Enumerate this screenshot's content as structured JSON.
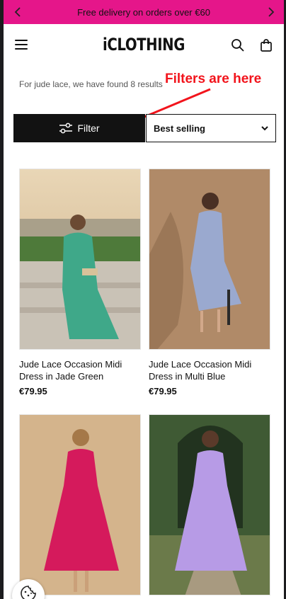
{
  "promo": {
    "text": "Free delivery on orders over €60"
  },
  "header": {
    "logo": "iCLOTHING"
  },
  "search": {
    "results_text": "For jude lace, we have found 8 results"
  },
  "annotation": {
    "text": "Filters are here",
    "color": "#f2141c"
  },
  "toolbar": {
    "filter_label": "Filter",
    "sort_selected": "Best selling"
  },
  "products": [
    {
      "name": "Jude Lace Occasion Midi Dress in Jade Green",
      "price": "€79.95",
      "dress_color": "#3fa889",
      "bg": "#d9c6a4"
    },
    {
      "name": "Jude Lace Occasion Midi Dress in Multi Blue",
      "price": "€79.95",
      "dress_color": "#9aa9cf",
      "bg": "#b08a68"
    },
    {
      "name": "",
      "price": "",
      "dress_color": "#d51a5c",
      "bg": "#d4b48c"
    },
    {
      "name": "",
      "price": "",
      "dress_color": "#b79be6",
      "bg": "#3f5a34"
    }
  ],
  "colors": {
    "accent": "#e5168a",
    "filter_bg": "#121212"
  },
  "icons": [
    "chevron-left-icon",
    "chevron-right-icon",
    "menu-icon",
    "search-icon",
    "bag-icon",
    "sliders-icon",
    "chevron-down-icon",
    "cookie-icon"
  ]
}
